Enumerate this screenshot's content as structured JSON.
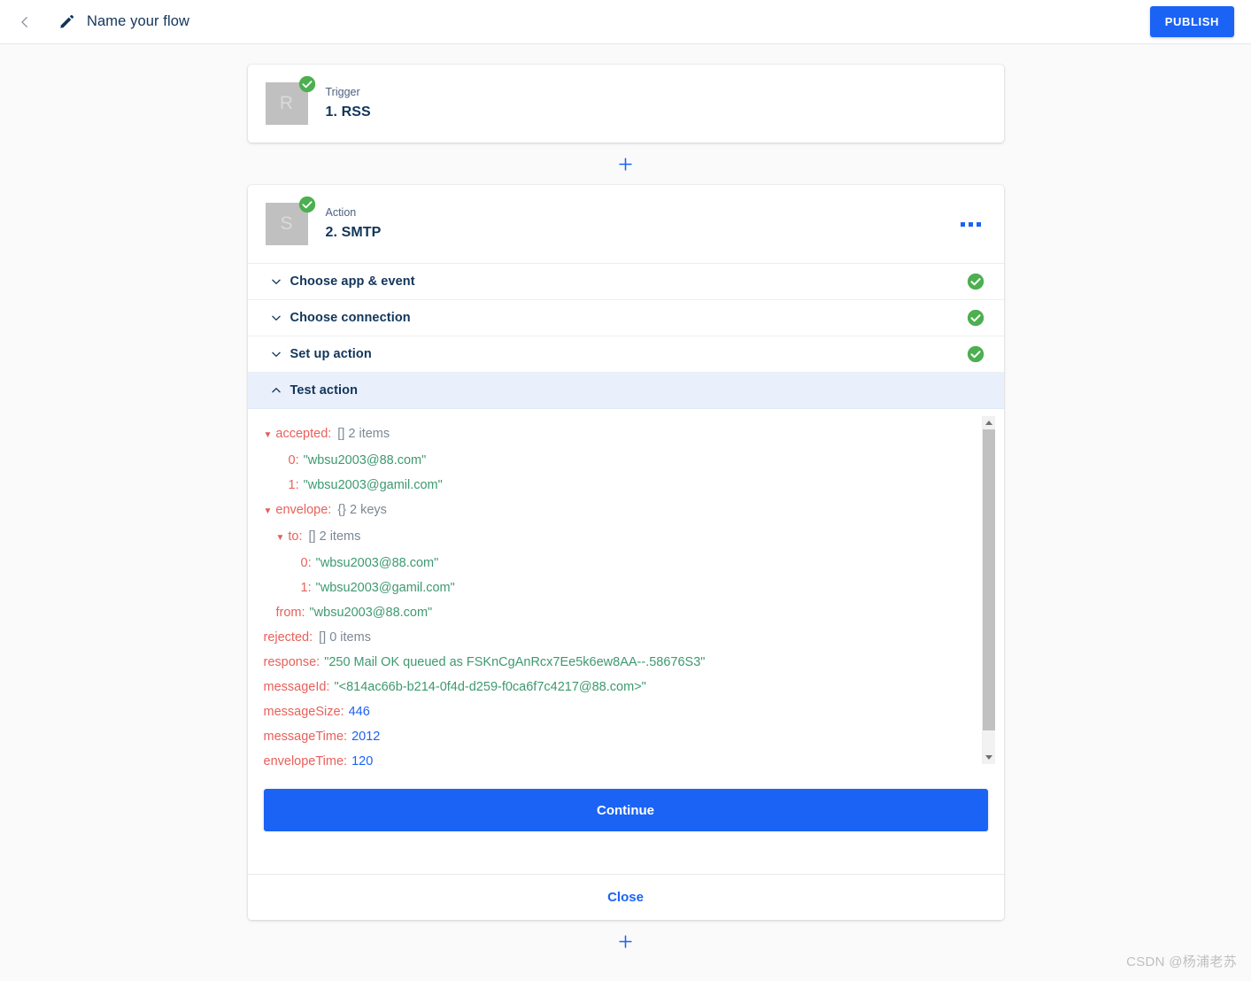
{
  "header": {
    "back_icon": "chevron-left-icon",
    "edit_icon": "pencil-icon",
    "flow_name": "Name your flow",
    "publish_label": "PUBLISH"
  },
  "trigger_card": {
    "avatar_letter": "R",
    "status_icon": "green-check-icon",
    "kind": "Trigger",
    "title": "1. RSS"
  },
  "action_card": {
    "avatar_letter": "S",
    "status_icon": "green-check-icon",
    "kind": "Action",
    "title": "2. SMTP",
    "menu_icon": "more-options-icon",
    "steps": [
      {
        "label": "Choose app & event",
        "expanded": false,
        "complete": true
      },
      {
        "label": "Choose connection",
        "expanded": false,
        "complete": true
      },
      {
        "label": "Set up action",
        "expanded": false,
        "complete": true
      },
      {
        "label": "Test action",
        "expanded": true,
        "complete": false
      }
    ],
    "continue_label": "Continue",
    "close_label": "Close"
  },
  "test_output": {
    "rows": [
      {
        "indent": 0,
        "tri": "▼",
        "key": "accepted:",
        "meta": "[]  2 items"
      },
      {
        "indent": 2,
        "tri": "",
        "key": "0:",
        "str": "\"wbsu2003@88.com\""
      },
      {
        "indent": 2,
        "tri": "",
        "key": "1:",
        "str": "\"wbsu2003@gamil.com\""
      },
      {
        "indent": 0,
        "tri": "▼",
        "key": "envelope:",
        "meta": "{}  2 keys"
      },
      {
        "indent": 1,
        "tri": "▼",
        "key": "to:",
        "meta": "[]  2 items"
      },
      {
        "indent": 3,
        "tri": "",
        "key": "0:",
        "str": "\"wbsu2003@88.com\""
      },
      {
        "indent": 3,
        "tri": "",
        "key": "1:",
        "str": "\"wbsu2003@gamil.com\""
      },
      {
        "indent": 1,
        "tri": "",
        "key": "from:",
        "str": "\"wbsu2003@88.com\""
      },
      {
        "indent": 0,
        "tri": "",
        "key": "rejected:",
        "meta": "[]  0 items"
      },
      {
        "indent": 0,
        "tri": "",
        "key": "response:",
        "str": "\"250 Mail OK queued as FSKnCgAnRcx7Ee5k6ew8AA--.58676S3\""
      },
      {
        "indent": 0,
        "tri": "",
        "key": "messageId:",
        "str": "\"<814ac66b-b214-0f4d-d259-f0ca6f7c4217@88.com>\""
      },
      {
        "indent": 0,
        "tri": "",
        "key": "messageSize:",
        "num": "446"
      },
      {
        "indent": 0,
        "tri": "",
        "key": "messageTime:",
        "num": "2012"
      },
      {
        "indent": 0,
        "tri": "",
        "key": "envelopeTime:",
        "num": "120"
      }
    ],
    "scrollbar": {
      "up_icon": "scroll-up-arrow-icon",
      "down_icon": "scroll-down-arrow-icon"
    }
  },
  "connectors": {
    "add_step_icon": "plus-icon"
  },
  "watermark": "CSDN @杨浦老苏",
  "colors": {
    "accent": "#1a63f5",
    "success": "#4caf50",
    "json_key": "#e8605a",
    "json_string": "#3d9970",
    "json_number": "#1a63f5",
    "active_row_bg": "#e9effb"
  }
}
